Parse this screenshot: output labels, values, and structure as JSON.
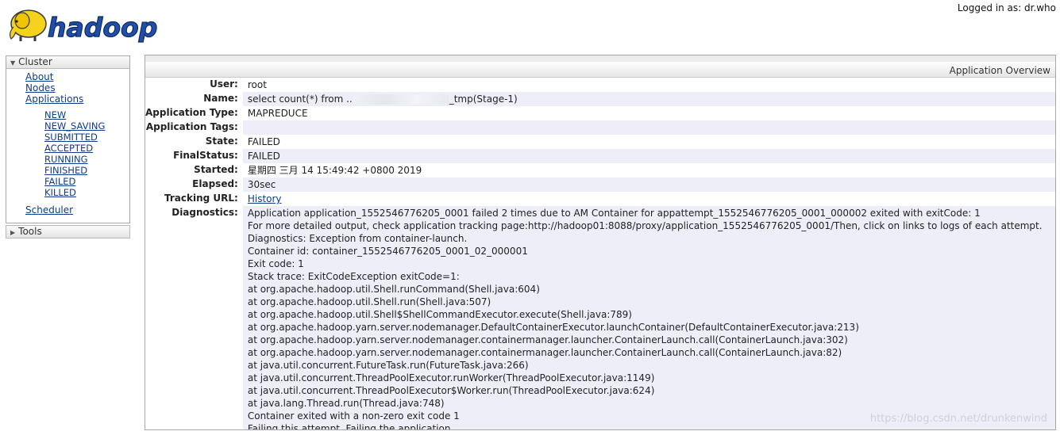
{
  "header": {
    "logo_text": "hadoop",
    "login_text": "Logged in as: dr.who"
  },
  "sidebar": {
    "cluster_label": "Cluster",
    "cluster_links": [
      "About",
      "Nodes",
      "Applications"
    ],
    "app_states": [
      "NEW",
      "NEW_SAVING",
      "SUBMITTED",
      "ACCEPTED",
      "RUNNING",
      "FINISHED",
      "FAILED",
      "KILLED"
    ],
    "scheduler_label": "Scheduler",
    "tools_label": "Tools"
  },
  "panel": {
    "title": "Application Overview",
    "rows": {
      "user": {
        "label": "User:",
        "value": "root"
      },
      "name": {
        "label": "Name:",
        "value_prefix": "select count(*) from ..",
        "value_suffix": "_tmp(Stage-1)"
      },
      "app_type": {
        "label": "Application Type:",
        "value": "MAPREDUCE"
      },
      "app_tags": {
        "label": "Application Tags:",
        "value": ""
      },
      "state": {
        "label": "State:",
        "value": "FAILED"
      },
      "final_status": {
        "label": "FinalStatus:",
        "value": "FAILED"
      },
      "started": {
        "label": "Started:",
        "value": "星期四 三月 14 15:49:42 +0800 2019"
      },
      "elapsed": {
        "label": "Elapsed:",
        "value": "30sec"
      },
      "tracking_url": {
        "label": "Tracking URL:",
        "value": "History"
      },
      "diagnostics": {
        "label": "Diagnostics:"
      }
    },
    "diagnostics_lines": [
      "Application application_1552546776205_0001 failed 2 times due to AM Container for appattempt_1552546776205_0001_000002 exited with exitCode: 1",
      "For more detailed output, check application tracking page:http://hadoop01:8088/proxy/application_1552546776205_0001/Then, click on links to logs of each attempt.",
      "Diagnostics: Exception from container-launch.",
      "Container id: container_1552546776205_0001_02_000001",
      "Exit code: 1",
      "Stack trace: ExitCodeException exitCode=1:",
      "at org.apache.hadoop.util.Shell.runCommand(Shell.java:604)",
      "at org.apache.hadoop.util.Shell.run(Shell.java:507)",
      "at org.apache.hadoop.util.Shell$ShellCommandExecutor.execute(Shell.java:789)",
      "at org.apache.hadoop.yarn.server.nodemanager.DefaultContainerExecutor.launchContainer(DefaultContainerExecutor.java:213)",
      "at org.apache.hadoop.yarn.server.nodemanager.containermanager.launcher.ContainerLaunch.call(ContainerLaunch.java:302)",
      "at org.apache.hadoop.yarn.server.nodemanager.containermanager.launcher.ContainerLaunch.call(ContainerLaunch.java:82)",
      "at java.util.concurrent.FutureTask.run(FutureTask.java:266)",
      "at java.util.concurrent.ThreadPoolExecutor.runWorker(ThreadPoolExecutor.java:1149)",
      "at java.util.concurrent.ThreadPoolExecutor$Worker.run(ThreadPoolExecutor.java:624)",
      "at java.lang.Thread.run(Thread.java:748)",
      "Container exited with a non-zero exit code 1",
      "Failing this attempt. Failing the application."
    ],
    "watermark": "https://blog.csdn.net/drunkenwind"
  },
  "colors": {
    "link": "#123a8a",
    "logo_yellow": "#f5d21c",
    "logo_blue": "#1f4fa8",
    "alt_row": "#eeeef9"
  }
}
